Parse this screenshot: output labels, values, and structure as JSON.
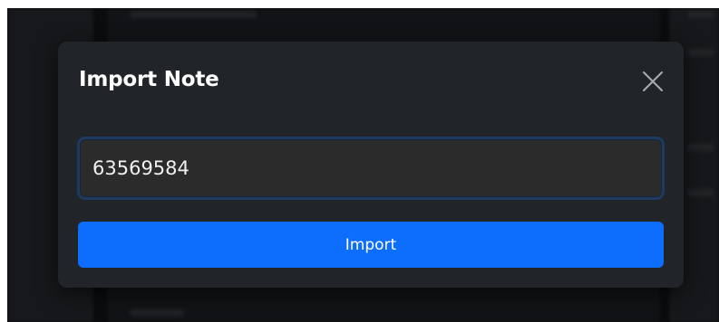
{
  "modal": {
    "title": "Import Note",
    "close_icon": "close-icon",
    "input": {
      "value": "63569584",
      "placeholder": ""
    },
    "import_label": "Import"
  },
  "colors": {
    "backdrop": "#0b0c0e",
    "modal_bg": "#212529",
    "input_bg": "#2b2b2b",
    "input_border": "#1e3a5f",
    "primary": "#0d6efd",
    "text": "#ffffff"
  }
}
